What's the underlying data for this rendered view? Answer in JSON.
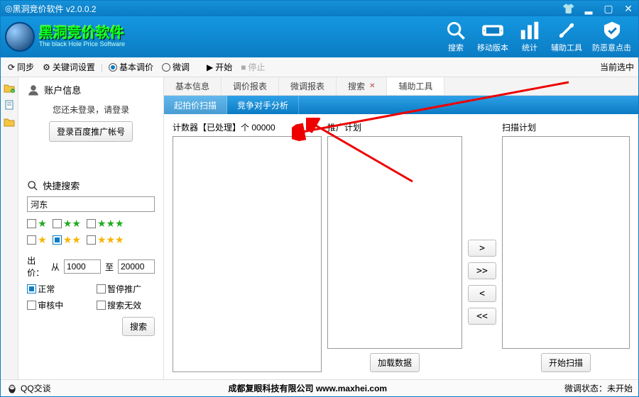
{
  "window": {
    "title": "黑洞竞价软件  v2.0.0.2"
  },
  "logo": {
    "cn": "黑洞竞价软件",
    "en": "The black Hole Price Software"
  },
  "header_tools": {
    "search": "搜索",
    "mobile": "移动版本",
    "stats": "统计",
    "aux": "辅助工具",
    "anti": "防恶意点击"
  },
  "toolbar": {
    "sync": "同步",
    "kw_setting": "关键词设置",
    "basic_radio": "基本调价",
    "fine_radio": "微调",
    "start": "开始",
    "stop": "停止",
    "current": "当前选中"
  },
  "sidebar": {
    "account_title": "账户信息",
    "login_msg": "您还未登录，请登录",
    "login_btn": "登录百度推广帐号",
    "quick_search": "快捷搜索",
    "search_value": "河东",
    "price_label": "出价：",
    "from": "从",
    "to": "至",
    "price_from": "1000",
    "price_to": "20000",
    "status": {
      "normal": "正常",
      "pause": "暂停推广",
      "review": "审核中",
      "invalid": "搜索无效"
    },
    "search_btn": "搜索"
  },
  "tabs1": {
    "basic": "基本信息",
    "price_report": "调价报表",
    "fine_report": "微调报表",
    "search": "搜索",
    "aux": "辅助工具"
  },
  "tabs2": {
    "scan": "起拍价扫描",
    "rival": "竞争对手分析"
  },
  "panels": {
    "counter_prefix": "计数器【已处理】个 ",
    "counter_value": "00000",
    "promo": "推广计划",
    "scan": "扫描计划",
    "load": "加载数据",
    "start_scan": "开始扫描"
  },
  "transfer": {
    "r1": ">",
    "r2": ">>",
    "l1": "<",
    "l2": "<<"
  },
  "status": {
    "qq": "QQ交谈",
    "company": "成都复眼科技有限公司 www.maxhei.com",
    "fine_state_label": "微调状态：",
    "fine_state_value": "未开始"
  }
}
